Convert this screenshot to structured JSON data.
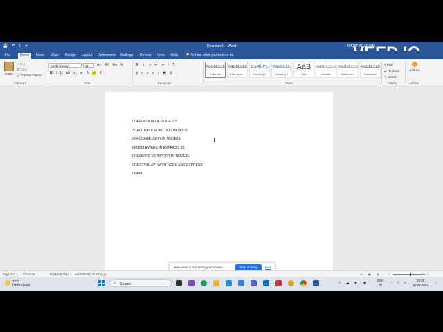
{
  "titlebar": {
    "title": "Document1 - Word",
    "user": "RAJAT AGARWAL",
    "qat": [
      "💾",
      "↶",
      "↻",
      "▾"
    ]
  },
  "watermark": "VEED.IO",
  "tabs": [
    "File",
    "Home",
    "Insert",
    "Draw",
    "Design",
    "Layout",
    "References",
    "Mailings",
    "Review",
    "View",
    "Help"
  ],
  "tell_me": "Tell me what you want to do",
  "ribbon": {
    "paste": "Paste",
    "cut": "Cut",
    "copy": "Copy",
    "format_painter": "Format Painter",
    "font_name": "Calibri (Body)",
    "font_size": "11",
    "styles": [
      {
        "sample": "AaBbCcDd",
        "name": "¶ Normal"
      },
      {
        "sample": "AaBbCcDd",
        "name": "¶ No Spac..."
      },
      {
        "sample": "AaBbCc",
        "name": "Heading 1"
      },
      {
        "sample": "AaBbCcC",
        "name": "Heading 2"
      },
      {
        "sample": "AaB",
        "name": "Title"
      },
      {
        "sample": "AaBbCcDd",
        "name": "Subtitle"
      },
      {
        "sample": "AaBbCcDd",
        "name": "Subtle Em..."
      },
      {
        "sample": "AaBbCcDd",
        "name": "Emphasis"
      }
    ],
    "find": "Find",
    "replace": "Replace",
    "select": "Select",
    "addins": "Add-ins",
    "groups": {
      "clipboard": "Clipboard",
      "font": "Font",
      "paragraph": "Paragraph",
      "styles": "Styles",
      "editing": "Editing",
      "addins": "Add-ins"
    }
  },
  "document": {
    "lines": [
      "1.DEFINITION OF NODEJS?",
      "2.CALL BACK FUNCTION IN NODE",
      "3.PACKAGE.JSON IN NODEJS",
      "4.MIDDLEWARE IN EXPRESS JS",
      "5.REQUIRE VS IMPORT IN NODEJS",
      "6.RESTFUL API WITH NODE AND EXPRESS",
      "7.NPM"
    ]
  },
  "status": {
    "page": "Page 1 of 1",
    "words": "27 words",
    "language": "English (India)",
    "accessibility": "Accessibility: Good to go"
  },
  "share_banner": {
    "message": "www.veed.io is sharing your screen.",
    "stop": "Stop sharing",
    "hide": "Hide"
  },
  "taskbar": {
    "temp": "27°C",
    "weather": "Partly cloudy",
    "search": "Search",
    "lang1": "ENG",
    "lang2": "IN",
    "time": "23:25",
    "date": "30-09-2023"
  }
}
